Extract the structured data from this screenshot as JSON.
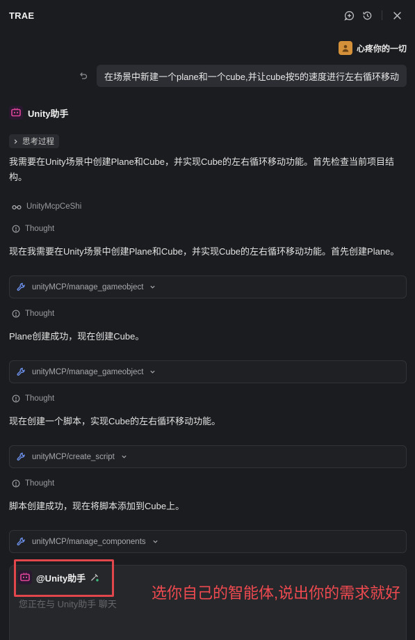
{
  "header": {
    "app_title": "TRAE",
    "icons": [
      "new-chat-icon",
      "history-icon",
      "close-icon"
    ]
  },
  "user": {
    "name": "心疼你的一切",
    "message": "在场景中新建一个plane和一个cube,并让cube按5的速度进行左右循环移动"
  },
  "assistant": {
    "name": "Unity助手",
    "think_label": "思考过程",
    "intro": "我需要在Unity场景中创建Plane和Cube，并实现Cube的左右循环移动功能。首先检查当前项目结构。",
    "project_name": "UnityMcpCeShi"
  },
  "steps": [
    {
      "thought_label": "Thought",
      "text": "现在我需要在Unity场景中创建Plane和Cube，并实现Cube的左右循环移动功能。首先创建Plane。",
      "tool": "unityMCP/manage_gameobject"
    },
    {
      "thought_label": "Thought",
      "text": "Plane创建成功，现在创建Cube。",
      "tool": "unityMCP/manage_gameobject"
    },
    {
      "thought_label": "Thought",
      "text": "现在创建一个脚本，实现Cube的左右循环移动功能。",
      "tool": "unityMCP/create_script"
    },
    {
      "thought_label": "Thought",
      "text": "脚本创建成功，现在将脚本添加到Cube上。",
      "tool": "unityMCP/manage_components"
    }
  ],
  "composer": {
    "agent_label": "@Unity助手",
    "placeholder": "您正在与 Unity助手 聊天"
  },
  "annotation": "选你自己的智能体,说出你的需求就好",
  "colors": {
    "background": "#1b1c1f",
    "annotation_red": "#e0464c",
    "avatar_orange": "#d4913a",
    "bot_pink": "#e0459a",
    "wrench_blue": "#6b8fe8"
  }
}
